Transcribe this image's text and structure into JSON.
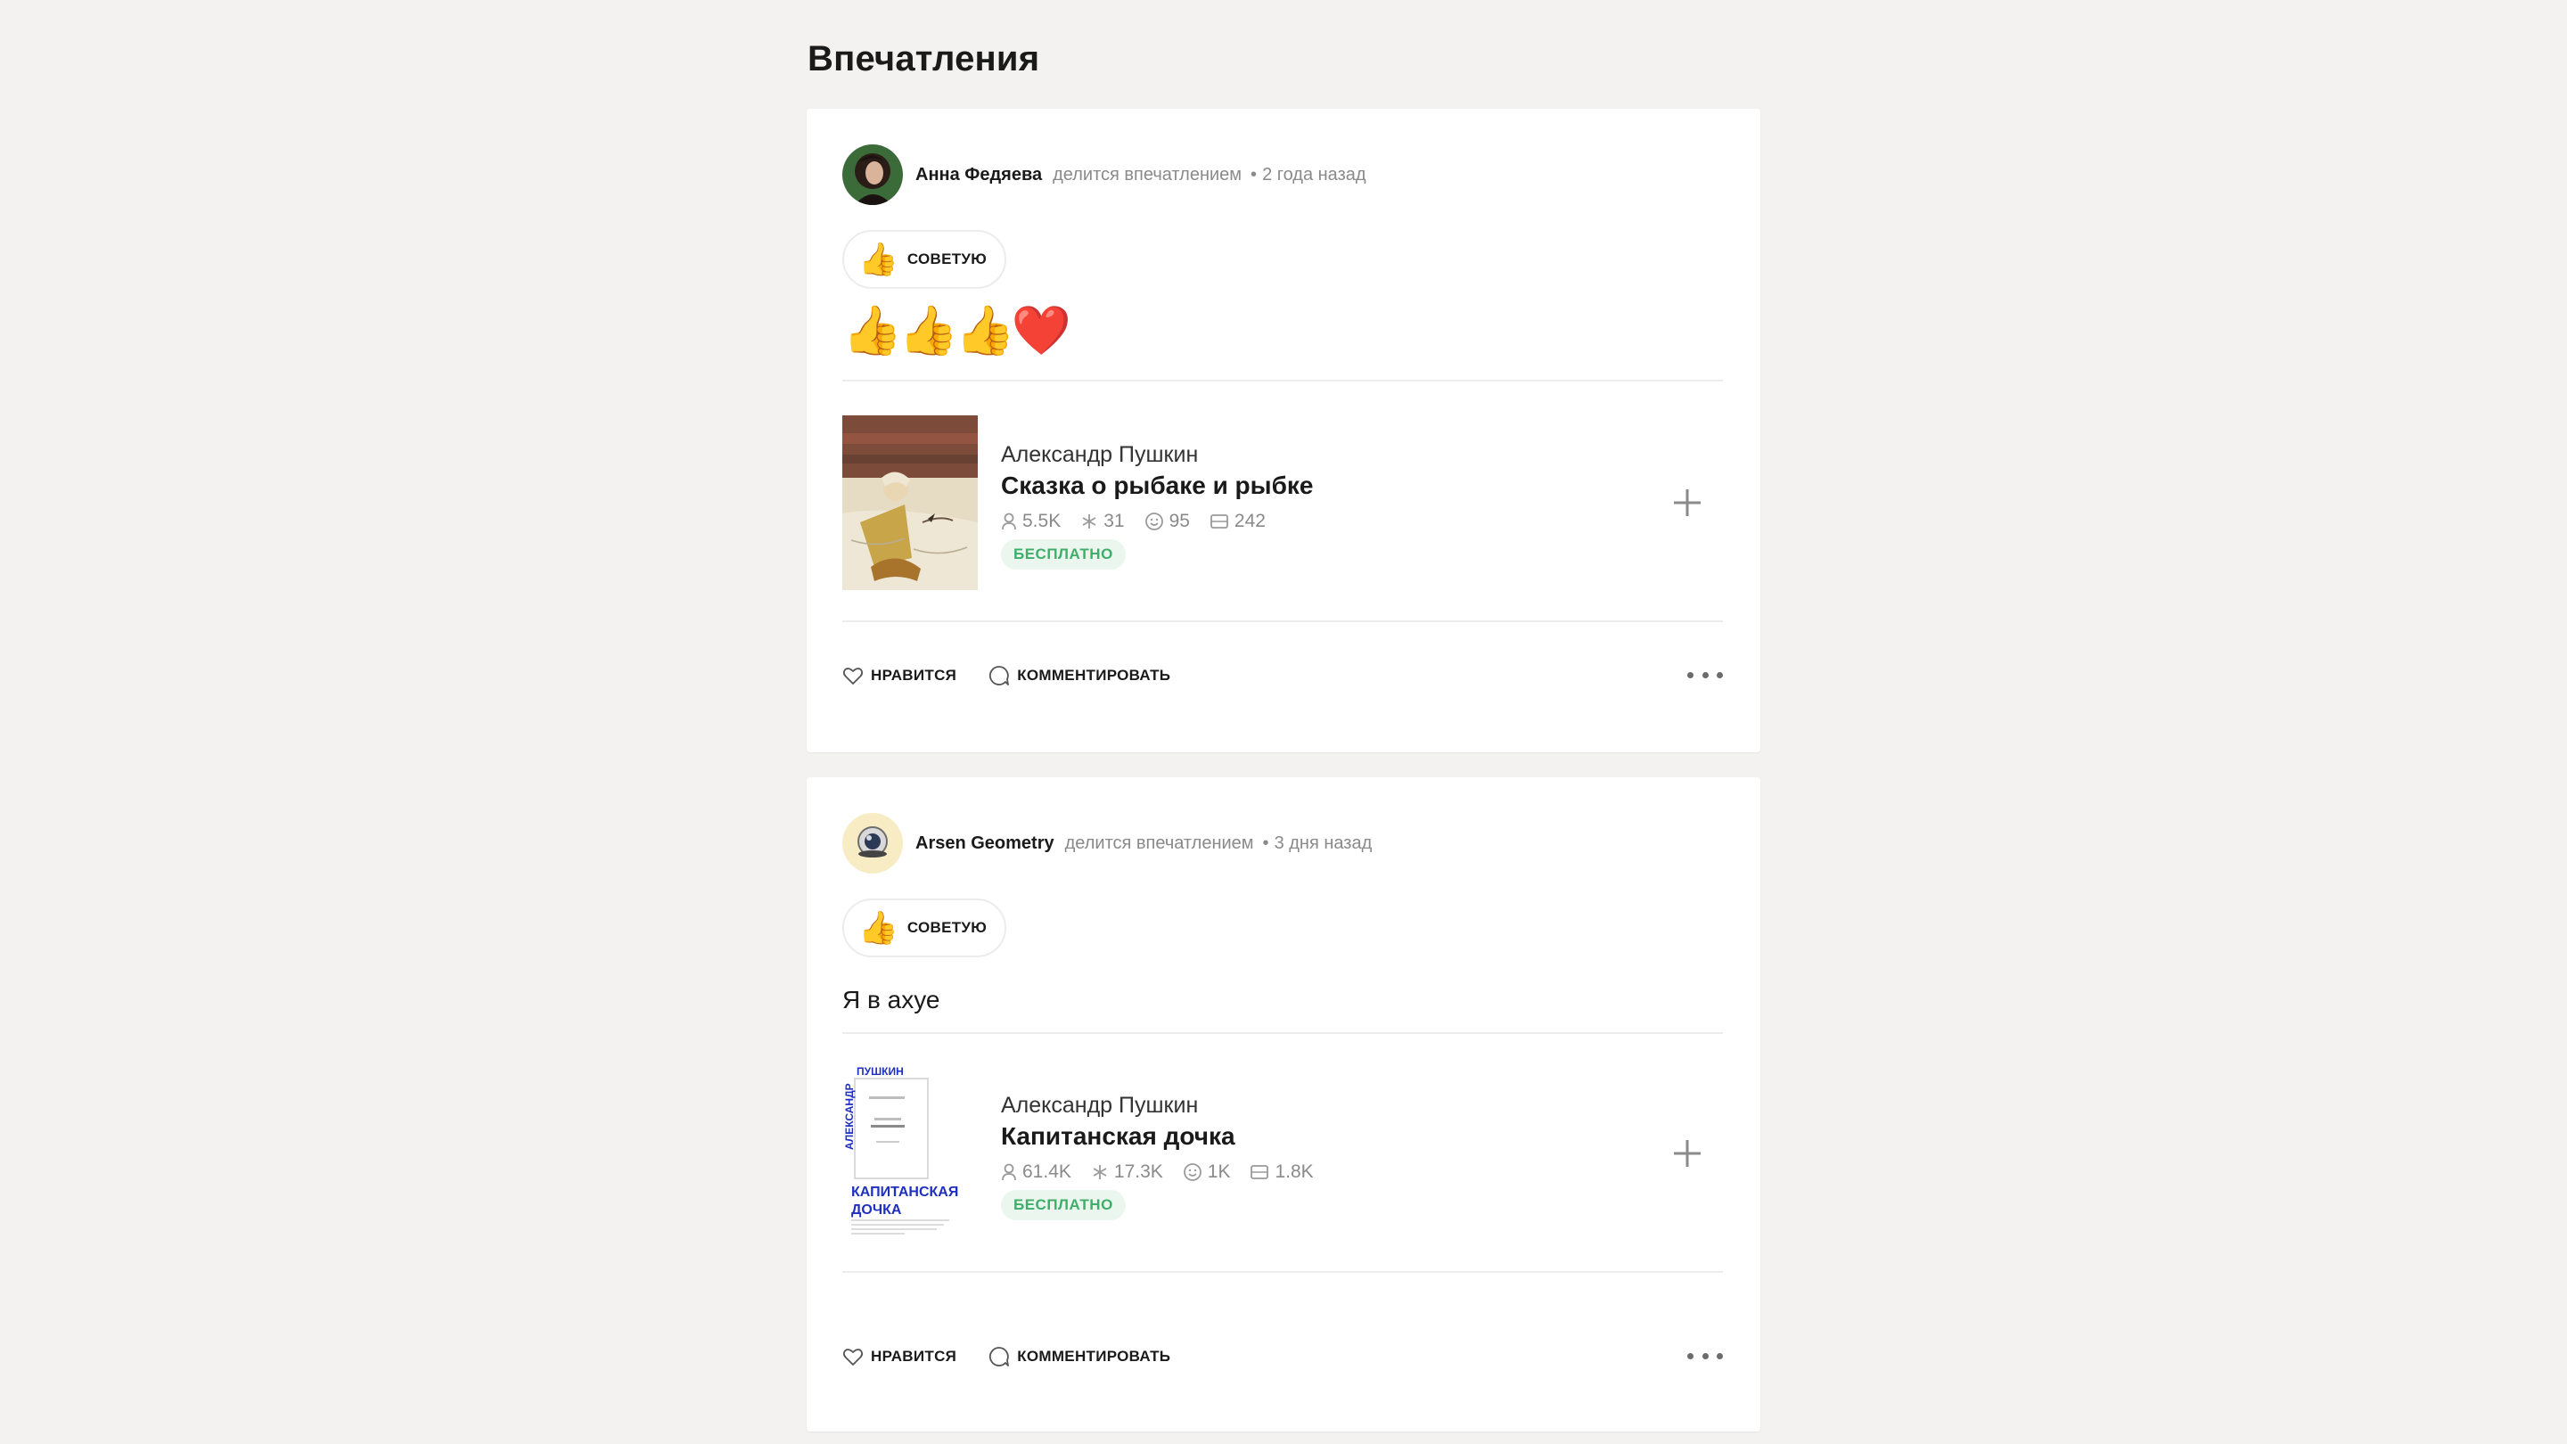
{
  "page": {
    "title": "Впечатления"
  },
  "posts": [
    {
      "author": "Анна Федяева",
      "action": "делится впечатлением",
      "separator": "•",
      "time": "2 года назад",
      "badge": {
        "emoji": "👍",
        "label": "СОВЕТУЮ"
      },
      "body_emoji": "👍👍👍❤️",
      "body_text": "",
      "book": {
        "author": "Александр Пушкин",
        "title": "Сказка о рыбаке и рыбке",
        "stats": {
          "readers": "5.5K",
          "quotes": "31",
          "impressions": "95",
          "pages": "242"
        },
        "price_label": "БЕСПЛАТНО"
      },
      "footer": {
        "like_label": "НРАВИТСЯ",
        "comment_label": "КОММЕНТИРОВАТЬ"
      }
    },
    {
      "author": "Arsen Geometry",
      "action": "делится впечатлением",
      "separator": "•",
      "time": "3 дня назад",
      "badge": {
        "emoji": "👍",
        "label": "СОВЕТУЮ"
      },
      "body_emoji": "",
      "body_text": "Я в ахуе",
      "book": {
        "author": "Александр Пушкин",
        "title": "Капитанская дочка",
        "stats": {
          "readers": "61.4K",
          "quotes": "17.3K",
          "impressions": "1K",
          "pages": "1.8K"
        },
        "price_label": "БЕСПЛАТНО",
        "cover_text": {
          "top": "ПУШКИН",
          "side": "АЛЕКСАНДР",
          "title_line1": "КАПИТАНСКАЯ",
          "title_line2": "ДОЧКА"
        }
      },
      "footer": {
        "like_label": "НРАВИТСЯ",
        "comment_label": "КОММЕНТИРОВАТЬ"
      }
    }
  ],
  "colors": {
    "background": "#f3f2f0",
    "card": "#ffffff",
    "muted_text": "#8a8a8a",
    "free_badge_bg": "#eaf6ee",
    "free_badge_text": "#3fae6a",
    "cover_blue": "#1f2fbf"
  },
  "icons": {
    "readers": "person-icon",
    "quotes": "star-icon",
    "impressions": "smile-icon",
    "pages": "book-icon",
    "add": "plus-icon",
    "like": "heart-icon",
    "comment": "comment-bubble-icon",
    "more": "ellipsis-icon"
  }
}
